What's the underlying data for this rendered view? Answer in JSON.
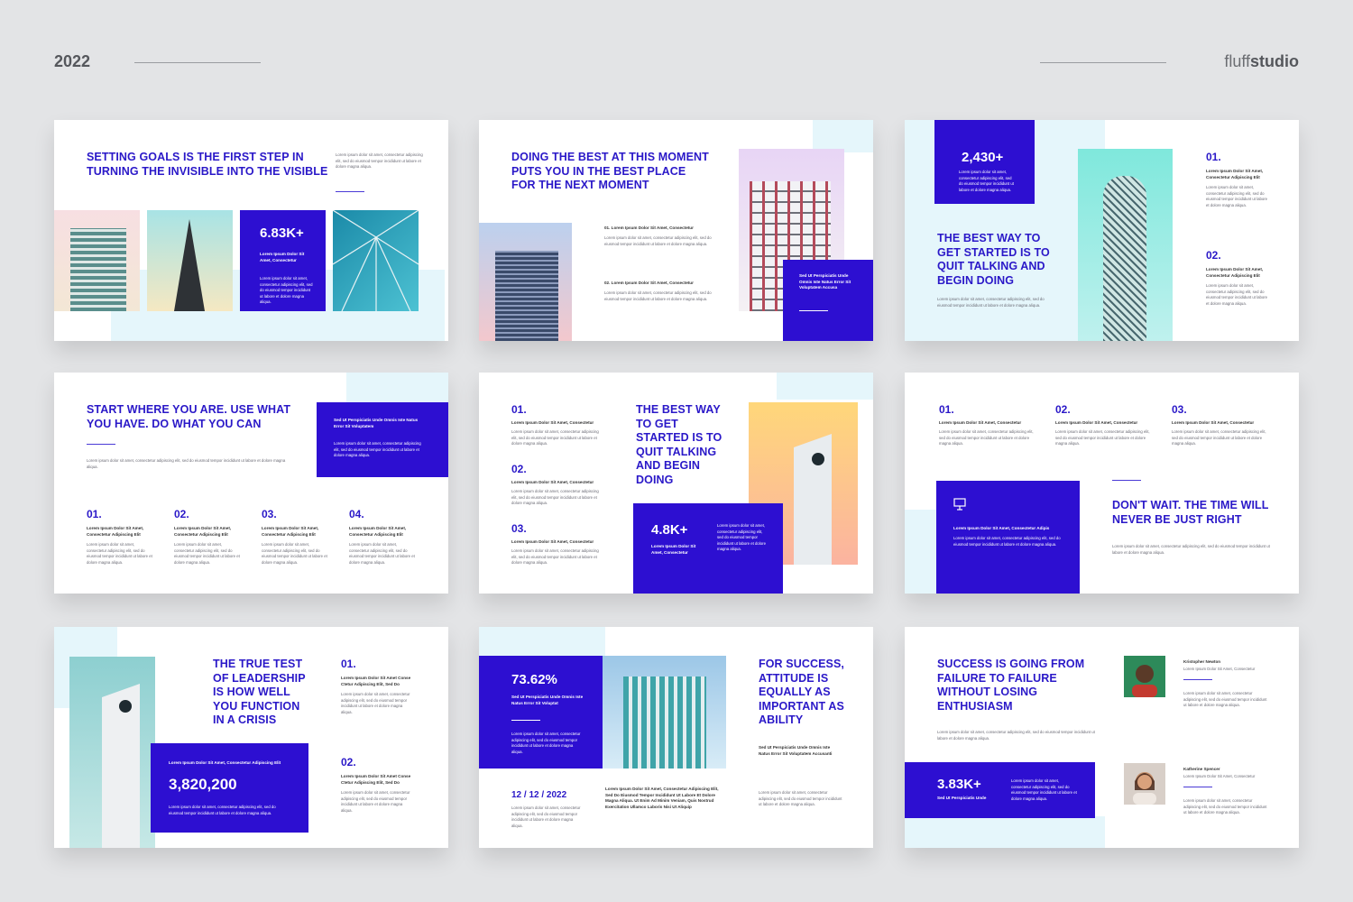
{
  "header": {
    "year": "2022",
    "brand_light": "fluff",
    "brand_bold": "studio"
  },
  "colors": {
    "accent": "#2d0fd1",
    "background": "#e3e4e6",
    "pale": "#e5f6fb"
  },
  "lorem": {
    "short": "Lorem Ipsum Dolor Sit Amet, Consectetur",
    "body": "Lorem ipsum dolor sit amet, consectetur adipiscing elit, sed do eiusmod tempor incididunt ut labore et dolore magna aliqua.",
    "sed": "Sed Ut Perspiciatis Unde Omnis Iste Natus Error Sit Voluptatem"
  },
  "slides": {
    "s1": {
      "title": "Setting goals is the first step in turning the invisible into the visible",
      "stat": "6.83K+",
      "stat_label": "Lorem Ipsum Dolor Sit Amet, Consectetur"
    },
    "s2": {
      "title": "Doing the best at this moment puts you in the best place for the next moment",
      "item1": "01. Lorem Ipsum Dolor Sit Amet, Consectetur",
      "item2": "02. Lorem Ipsum Dolor Sit Amet, Consectetur",
      "box": "Sed Ut Perspiciatis Unde Omnis Iste Natus Error Sit Voluptatem Accusa"
    },
    "s3": {
      "stat": "2,430+",
      "title": "The best way to get started is to quit talking and begin doing",
      "n1": "01.",
      "n2": "02.",
      "label": "Lorem Ipsum Dolor Sit Amet, Consectetur Adipiscing Elit"
    },
    "s4": {
      "title": "Start where you are. Use what you have. Do what you can",
      "box": "Sed Ut Perspiciatis Unde Omnis Iste Natus Error Sit Voluptatem",
      "n1": "01.",
      "n2": "02.",
      "n3": "03.",
      "n4": "04.",
      "label": "Lorem Ipsum Dolor Sit Amet, Consectetur Adipiscing Elit"
    },
    "s5": {
      "n1": "01.",
      "n2": "02.",
      "n3": "03.",
      "title": "The best way to get started is to quit talking and begin doing",
      "stat": "4.8K+",
      "stat_label": "Lorem Ipsum Dolor Sit Amet, Consectetur"
    },
    "s6": {
      "n1": "01.",
      "n2": "02.",
      "n3": "03.",
      "box_label": "Lorem Ipsum Dolor Sit Amet, Consectetur Adipis",
      "title": "Don't wait. The time will never be just right"
    },
    "s7": {
      "title": "The true test of leadership is how well you function in a crisis",
      "box_label": "Lorem Ipsum Dolor Sit Amet, Consectetur Adipiscing Elit",
      "stat": "3,820,200",
      "n1": "01.",
      "n2": "02.",
      "label": "Lorem Ipsum Dolor Sit Amet Conse Ctetur Adipiscing Elit, Sed Do"
    },
    "s8": {
      "stat": "73.62%",
      "stat_label": "Sed Ut Perspiciatis Unde Omnis Iste Natus Error Sit Voluptat",
      "date": "12 / 12 / 2022",
      "caption": "Lorem Ipsum Dolor Sit Amet, Consectetur Adipiscing Elit, Sed Do Eiusmod Tempor Incididunt Ut Labore Et Dolore Magna Aliqua. Ut Enim Ad Minim Veniam, Quis Nostrud Exercitation Ullamco Laboris Nisi Ut Aliquip",
      "title": "For success, attitude is equally as important as ability",
      "sub": "Sed Ut Perspiciatis Unde Omnis Iste Natus Error Sit Voluptatem Accusanti"
    },
    "s9": {
      "title": "Success is going from failure to failure without losing enthusiasm",
      "stat": "3.83K+",
      "stat_label": "Sed Ut Perspiciatis Unde",
      "person1": "Kristopher Newton",
      "person2": "Katherine Spencer"
    }
  }
}
